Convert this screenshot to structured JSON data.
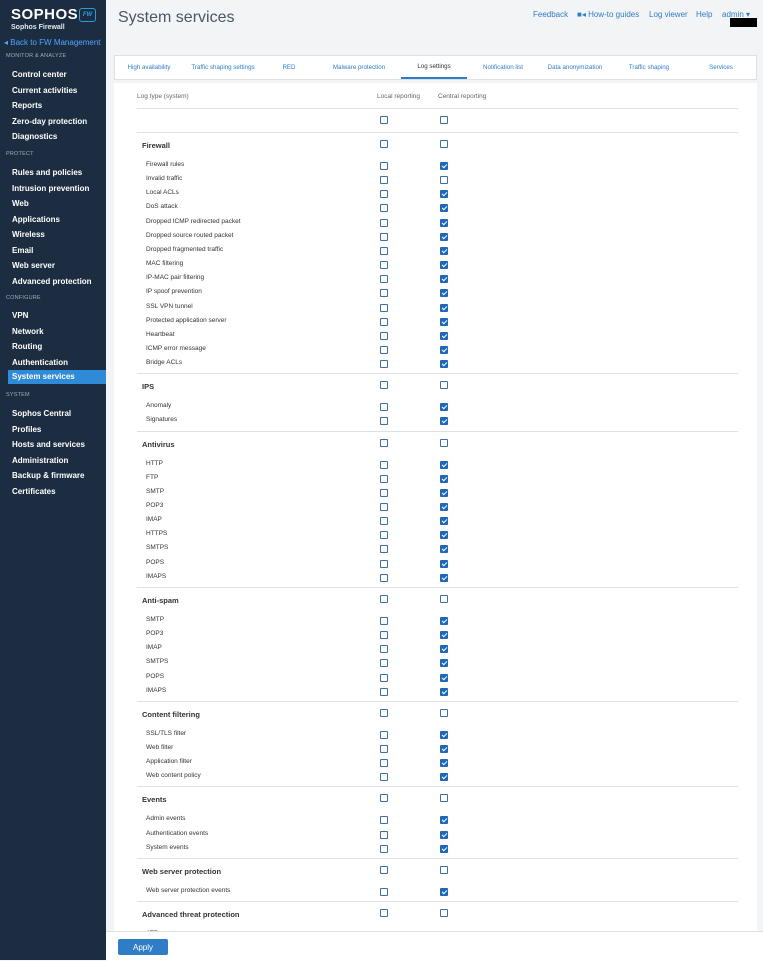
{
  "brand": {
    "name": "SOPHOS",
    "product": "Sophos Firewall",
    "badge": "FW"
  },
  "sidebar": {
    "back": "Back to FW Management",
    "sections": [
      {
        "heading": "MONITOR & ANALYZE",
        "items": [
          "Control center",
          "Current activities",
          "Reports",
          "Zero-day protection",
          "Diagnostics"
        ]
      },
      {
        "heading": "PROTECT",
        "items": [
          "Rules and policies",
          "Intrusion prevention",
          "Web",
          "Applications",
          "Wireless",
          "Email",
          "Web server",
          "Advanced protection"
        ]
      },
      {
        "heading": "CONFIGURE",
        "items": [
          "VPN",
          "Network",
          "Routing",
          "Authentication",
          "System services"
        ]
      },
      {
        "heading": "SYSTEM",
        "items": [
          "Sophos Central",
          "Profiles",
          "Hosts and services",
          "Administration",
          "Backup & firmware",
          "Certificates"
        ]
      }
    ],
    "active": "System services"
  },
  "header": {
    "title": "System services",
    "links": {
      "feedback": "Feedback",
      "guides": "How-to guides",
      "log_viewer": "Log viewer",
      "help": "Help",
      "user": "admin"
    }
  },
  "tabs": [
    "High availability",
    "Traffic shaping settings",
    "RED",
    "Malware protection",
    "Log settings",
    "Notification list",
    "Data anonymization",
    "Traffic shaping",
    "Services"
  ],
  "active_tab": "Log settings",
  "columns": {
    "type": "Log type (system)",
    "local": "Local reporting",
    "central": "Central reporting"
  },
  "groups": [
    {
      "name": "",
      "local": false,
      "central": false,
      "rows": []
    },
    {
      "name": "Firewall",
      "local": false,
      "central": false,
      "rows": [
        [
          "Firewall rules",
          false,
          true
        ],
        [
          "Invalid traffic",
          false,
          false
        ],
        [
          "Local ACLs",
          false,
          true
        ],
        [
          "DoS attack",
          false,
          true
        ],
        [
          "Dropped ICMP redirected packet",
          false,
          true
        ],
        [
          "Dropped source routed packet",
          false,
          true
        ],
        [
          "Dropped fragmented traffic",
          false,
          true
        ],
        [
          "MAC filtering",
          false,
          true
        ],
        [
          "IP-MAC pair filtering",
          false,
          true
        ],
        [
          "IP spoof prevention",
          false,
          true
        ],
        [
          "SSL VPN tunnel",
          false,
          true
        ],
        [
          "Protected application server",
          false,
          true
        ],
        [
          "Heartbeat",
          false,
          true
        ],
        [
          "ICMP error message",
          false,
          true
        ],
        [
          "Bridge ACLs",
          false,
          true
        ]
      ]
    },
    {
      "name": "IPS",
      "local": false,
      "central": false,
      "rows": [
        [
          "Anomaly",
          false,
          true
        ],
        [
          "Signatures",
          false,
          true
        ]
      ]
    },
    {
      "name": "Antivirus",
      "local": false,
      "central": false,
      "rows": [
        [
          "HTTP",
          false,
          true
        ],
        [
          "FTP",
          false,
          true
        ],
        [
          "SMTP",
          false,
          true
        ],
        [
          "POP3",
          false,
          true
        ],
        [
          "IMAP",
          false,
          true
        ],
        [
          "HTTPS",
          false,
          true
        ],
        [
          "SMTPS",
          false,
          true
        ],
        [
          "POPS",
          false,
          true
        ],
        [
          "IMAPS",
          false,
          true
        ]
      ]
    },
    {
      "name": "Anti-spam",
      "local": false,
      "central": false,
      "rows": [
        [
          "SMTP",
          false,
          true
        ],
        [
          "POP3",
          false,
          true
        ],
        [
          "IMAP",
          false,
          true
        ],
        [
          "SMTPS",
          false,
          true
        ],
        [
          "POPS",
          false,
          true
        ],
        [
          "IMAPS",
          false,
          true
        ]
      ]
    },
    {
      "name": "Content filtering",
      "local": false,
      "central": false,
      "rows": [
        [
          "SSL/TLS filter",
          false,
          true
        ],
        [
          "Web filter",
          false,
          true
        ],
        [
          "Application filter",
          false,
          true
        ],
        [
          "Web content policy",
          false,
          true
        ]
      ]
    },
    {
      "name": "Events",
      "local": false,
      "central": false,
      "rows": [
        [
          "Admin events",
          false,
          true
        ],
        [
          "Authentication events",
          false,
          true
        ],
        [
          "System events",
          false,
          true
        ]
      ]
    },
    {
      "name": "Web server protection",
      "local": false,
      "central": false,
      "rows": [
        [
          "Web server protection events",
          false,
          true
        ]
      ]
    },
    {
      "name": "Advanced threat protection",
      "local": false,
      "central": false,
      "rows": [
        [
          "ATP events",
          false,
          true
        ]
      ]
    }
  ],
  "footer": {
    "apply": "Apply"
  }
}
